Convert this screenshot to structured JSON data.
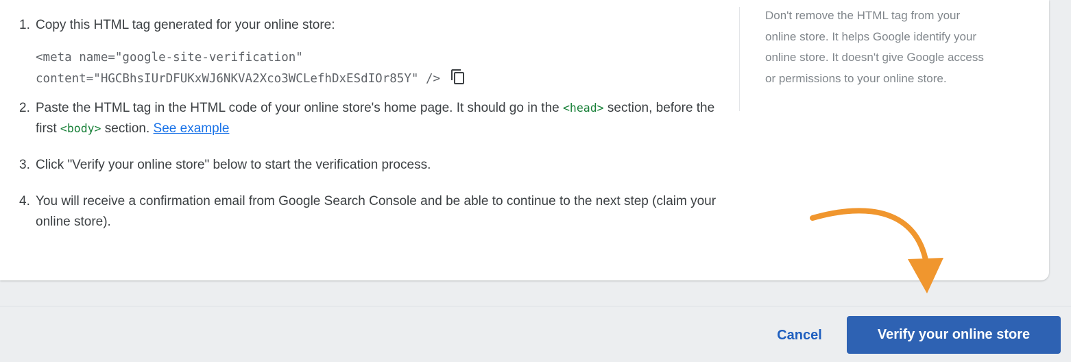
{
  "steps": [
    {
      "number": "1.",
      "text": "Copy this HTML tag generated for your online store:",
      "code_line_1": "<meta name=\"google-site-verification\"",
      "code_line_2": "content=\"HGCBhsIUrDFUKxWJ6NKVA2Xco3WCLefhDxESdIOr85Y\" />",
      "copy_icon": "copy-icon"
    },
    {
      "number": "2.",
      "text_before": "Paste the HTML tag in the HTML code of your online store's home page. It should go in the ",
      "head_tag": "<head>",
      "text_middle": " section, before the first ",
      "body_tag": "<body>",
      "text_after": " section. ",
      "link": "See example"
    },
    {
      "number": "3.",
      "text": "Click \"Verify your online store\" below to start the verification process."
    },
    {
      "number": "4.",
      "text": "You will receive a confirmation email from Google Search Console and be able to continue to the next step (claim your online store)."
    }
  ],
  "side_note": "Don't remove the HTML tag from your online store. It helps Google identify your online store. It doesn't give Google access or permissions to your online store.",
  "footer": {
    "cancel_label": "Cancel",
    "verify_label": "Verify your online store"
  },
  "colors": {
    "primary_button": "#2e62b3",
    "link": "#1a73e8",
    "code_tag": "#188038",
    "annotation_arrow": "#f0962e"
  }
}
